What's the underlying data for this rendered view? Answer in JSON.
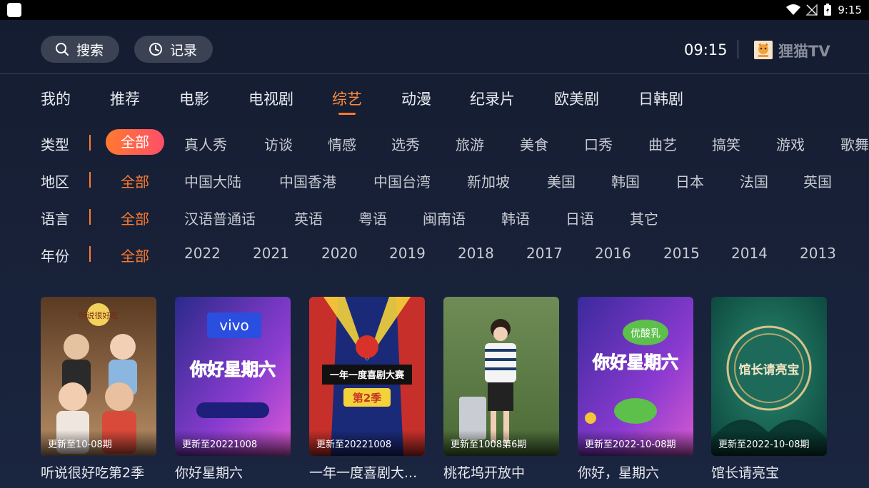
{
  "status_bar": {
    "time": "9:15"
  },
  "header": {
    "search_label": "搜索",
    "history_label": "记录",
    "clock": "09:15",
    "brand": "狸猫TV"
  },
  "tabs": [
    "我的",
    "推荐",
    "电影",
    "电视剧",
    "综艺",
    "动漫",
    "纪录片",
    "欧美剧",
    "日韩剧"
  ],
  "active_tab": "综艺",
  "filters": [
    {
      "label": "类型",
      "options": [
        "全部",
        "真人秀",
        "访谈",
        "情感",
        "选秀",
        "旅游",
        "美食",
        "口秀",
        "曲艺",
        "搞笑",
        "游戏",
        "歌舞"
      ],
      "selected": "全部"
    },
    {
      "label": "地区",
      "options": [
        "全部",
        "中国大陆",
        "中国香港",
        "中国台湾",
        "新加坡",
        "美国",
        "韩国",
        "日本",
        "法国",
        "英国"
      ],
      "selected": "全部"
    },
    {
      "label": "语言",
      "options": [
        "全部",
        "汉语普通话",
        "英语",
        "粤语",
        "闽南语",
        "韩语",
        "日语",
        "其它"
      ],
      "selected": "全部"
    },
    {
      "label": "年份",
      "options": [
        "全部",
        "2022",
        "2021",
        "2020",
        "2019",
        "2018",
        "2017",
        "2016",
        "2015",
        "2014",
        "2013"
      ],
      "selected": "全部"
    }
  ],
  "cards": [
    {
      "title": "听说很好吃第2季",
      "update": "更新至10-08期",
      "poster_text": "听说很好吃",
      "colors": [
        "#6b4a2c",
        "#c9a27a"
      ]
    },
    {
      "title": "你好星期六",
      "update": "更新至20221008",
      "poster_text": "你好星期六",
      "badge": "vivo",
      "colors": [
        "#3a2a8c",
        "#c04ad6"
      ]
    },
    {
      "title": "一年一度喜剧大...",
      "update": "更新至20221008",
      "poster_text": "一年一度喜剧大赛",
      "sub": "第2季",
      "colors": [
        "#1f2f7a",
        "#c0302a"
      ]
    },
    {
      "title": "桃花坞开放中",
      "update": "更新至1008第6期",
      "poster_text": "",
      "colors": [
        "#4d6b3a",
        "#9fb88a"
      ]
    },
    {
      "title": "你好，星期六",
      "update": "更新至2022-10-08期",
      "poster_text": "你好星期六",
      "badge": "优酸乳",
      "colors": [
        "#4a2a9c",
        "#d05ad0"
      ]
    },
    {
      "title": "馆长请亮宝",
      "update": "更新至2022-10-08期",
      "poster_text": "馆长请亮宝",
      "colors": [
        "#0f5a4e",
        "#3a9a80"
      ]
    }
  ]
}
